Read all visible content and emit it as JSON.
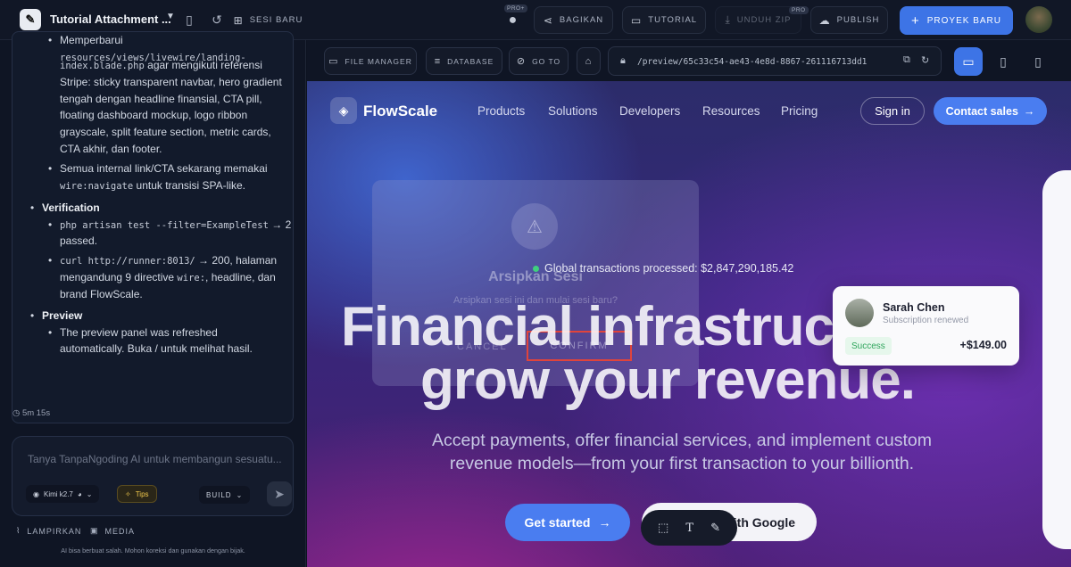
{
  "topbar": {
    "project_title": "Tutorial Attachment ...",
    "pro_badge": "PRO+",
    "share": "BAGIKAN",
    "tutorial": "TUTORIAL",
    "download_zip": "UNDUH ZIP",
    "download_pro_badge": "PRO",
    "publish": "PUBLISH",
    "new_session": "SESI BARU",
    "new_project": "PROYEK BARU"
  },
  "chat": {
    "line_a": "Memperbarui",
    "line_b": "resources/views/livewire/landing-",
    "line_c": "index.blade.php",
    "line_c_rest": " agar mengikuti referensi",
    "line_d": "Stripe: sticky transparent navbar, hero gradient",
    "line_e": "tengah dengan headline finansial, CTA pill,",
    "line_f": "floating dashboard mockup, logo ribbon",
    "line_g": "grayscale, split feature section, metric cards,",
    "line_h": "CTA akhir, dan footer.",
    "nav_1": "Semua internal link/CTA sekarang memakai",
    "nav_2_code": "wire:navigate",
    "nav_2_rest": " untuk transisi SPA-like.",
    "verification": "Verification",
    "ver_1_code": "php artisan test --filter=ExampleTest",
    "ver_1_rest": " → 2",
    "ver_1b": "passed.",
    "ver_2_code": "curl http://runner:8013/",
    "ver_2_rest": " → 200, halaman",
    "ver_2b_pre": "mengandung 9 directive ",
    "ver_2b_code": "wire:",
    "ver_2b_rest": ", headline, dan",
    "ver_2c": "brand FlowScale.",
    "preview": "Preview",
    "prev_1": "The preview panel was refreshed",
    "prev_2": "automatically. Buka / untuk melihat hasil."
  },
  "timer": "5m 15s",
  "composer": {
    "placeholder": "Tanya TanpaNgoding AI untuk membangun sesuatu...",
    "model": "Kimi k2.7",
    "tips": "Tips",
    "mode": "BUILD",
    "attach": "LAMPIRKAN",
    "media": "MEDIA",
    "disclaimer": "AI bisa berbuat salah. Mohon koreksi dan gunakan dengan bijak."
  },
  "preview_toolbar": {
    "file_manager": "FILE MANAGER",
    "database": "DATABASE",
    "goto": "GO TO",
    "url": "/preview/65c33c54-ae43-4e8d-8867-261116713dd1"
  },
  "site": {
    "brand": "FlowScale",
    "nav": [
      "Products",
      "Solutions",
      "Developers",
      "Resources",
      "Pricing"
    ],
    "sign_in": "Sign in",
    "contact": "Contact sales",
    "transactions": "Global transactions processed: $2,847,290,185.42",
    "headline_1": "Financial infrastruct",
    "headline_2": "grow your revenue.",
    "subhead_1": "Accept payments, offer financial services, and implement custom",
    "subhead_2": "revenue models—from your first transaction to your billionth.",
    "get_started": "Get started",
    "google": "with Google",
    "card": {
      "name": "Sarah Chen",
      "status": "Subscription renewed",
      "badge": "Success",
      "amount": "+$149.00"
    },
    "modal": {
      "title": "Arsipkan Sesi",
      "subtitle": "Arsipkan sesi ini dan mulai sesi baru?",
      "cancel": "CANCEL",
      "confirm": "CONFIRM"
    }
  }
}
